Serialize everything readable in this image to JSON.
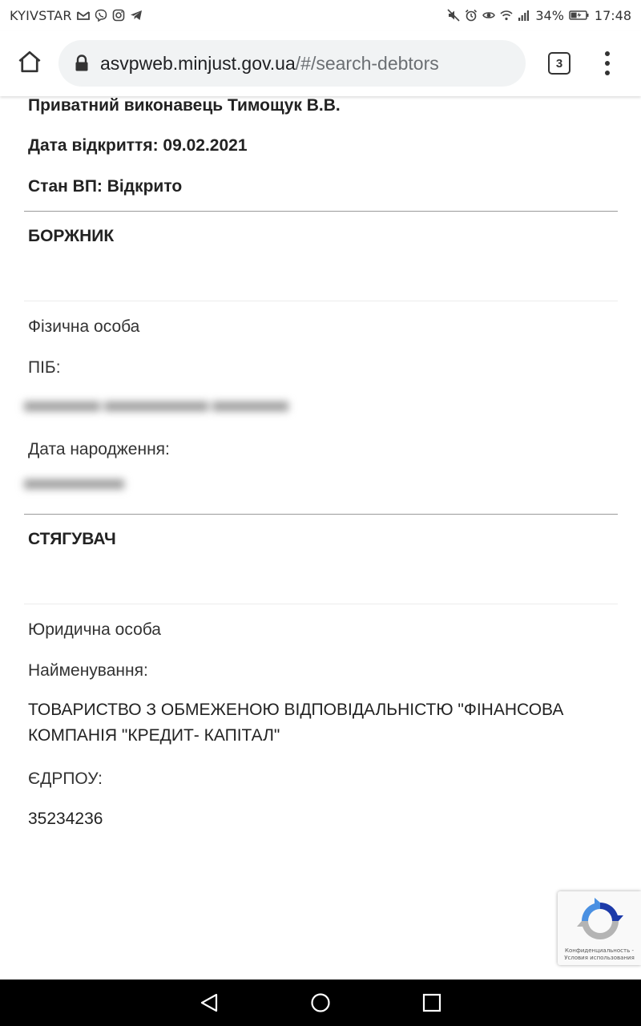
{
  "status_bar": {
    "carrier": "KYIVSTAR",
    "battery_percent": "34%",
    "time": "17:48",
    "left_icons": [
      "gmail-icon",
      "viber-icon",
      "instagram-icon",
      "telegram-icon"
    ],
    "right_icons": [
      "mute-icon",
      "alarm-icon",
      "eye-comfort-icon",
      "wifi-icon",
      "signal-icon",
      "battery-charging-icon"
    ]
  },
  "browser": {
    "url_host": "asvpweb.minjust.gov.ua",
    "url_path": "/#/search-debtors",
    "tab_count": "3"
  },
  "proceeding": {
    "executor": "Приватний виконавець Тимощук В.В.",
    "open_date": "Дата відкриття: 09.02.2021",
    "status": "Стан ВП: Відкрито"
  },
  "debtor": {
    "heading": "БОРЖНИК",
    "person_type": "Фізична особа",
    "name_label": "ПІБ:",
    "birth_label": "Дата народження:"
  },
  "creditor": {
    "heading": "СТЯГУВАЧ",
    "person_type": "Юридична особа",
    "name_label": "Найменування:",
    "name_value": "ТОВАРИСТВО З ОБМЕЖЕНОЮ ВІДПОВІДАЛЬНІСТЮ \"ФІНАНСОВА КОМПАНІЯ \"КРЕДИТ- КАПІТАЛ\"",
    "code_label": "ЄДРПОУ:",
    "code_value": "35234236"
  },
  "recaptcha": {
    "privacy": "Конфиденциальность",
    "separator": "-",
    "terms": "Условия использования"
  },
  "colors": {
    "recaptcha_blue": "#1c3aa9",
    "recaptcha_light_blue": "#4a90e2",
    "recaptcha_gray": "#b4b4b4"
  }
}
